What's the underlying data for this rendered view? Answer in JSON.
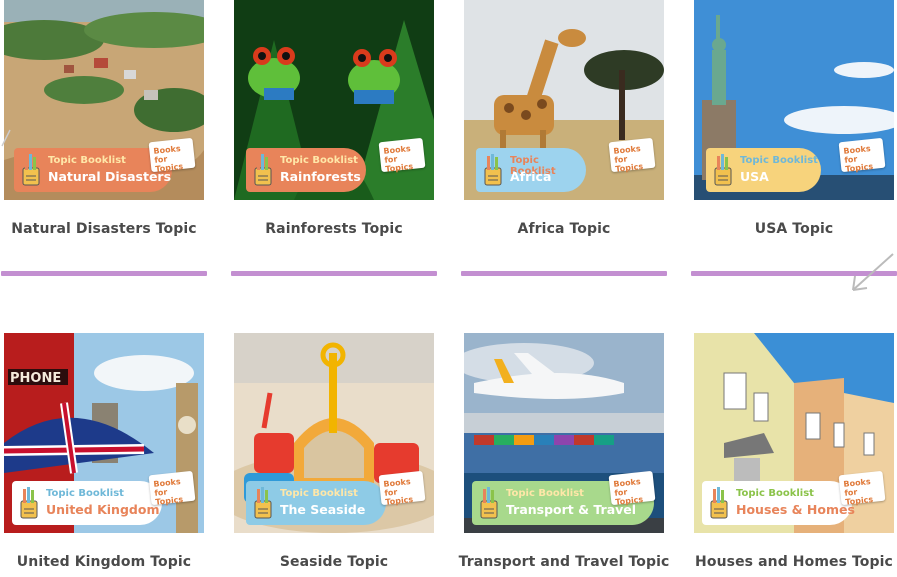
{
  "topics": [
    {
      "title": "Natural Disasters Topic",
      "banner": {
        "kicker": "Topic Booklist",
        "name": "Natural Disasters"
      },
      "logo": "Books for Topics",
      "colors": {
        "banner": "#e8845a",
        "kicker": "#ffe7a8",
        "name": "#ffffff"
      }
    },
    {
      "title": "Rainforests Topic",
      "banner": {
        "kicker": "Topic Booklist",
        "name": "Rainforests"
      },
      "logo": "Books for Topics",
      "colors": {
        "banner": "#e8845a",
        "kicker": "#ffe7a8",
        "name": "#ffffff"
      }
    },
    {
      "title": "Africa Topic",
      "banner": {
        "kicker": "Topic Booklist",
        "name": "Africa"
      },
      "logo": "Books for Topics",
      "colors": {
        "banner": "#9dd3ee",
        "kicker": "#e8845a",
        "name": "#ffffff"
      }
    },
    {
      "title": "USA Topic",
      "banner": {
        "kicker": "Topic Booklist",
        "name": "USA"
      },
      "logo": "Books for Topics",
      "colors": {
        "banner": "#f7d37c",
        "kicker": "#6fb8d8",
        "name": "#ffffff"
      }
    },
    {
      "title": "United Kingdom Topic",
      "banner": {
        "kicker": "Topic Booklist",
        "name": "United Kingdom"
      },
      "logo": "Books for Topics",
      "colors": {
        "banner": "#ffffff",
        "kicker": "#6fb8d8",
        "name": "#e8845a"
      }
    },
    {
      "title": "Seaside Topic",
      "banner": {
        "kicker": "Topic Booklist",
        "name": "The Seaside"
      },
      "logo": "Books for Topics",
      "colors": {
        "banner": "#8ecbe6",
        "kicker": "#ffe7a8",
        "name": "#ffffff"
      }
    },
    {
      "title": "Transport and Travel Topic",
      "banner": {
        "kicker": "Topic Booklist",
        "name": "Transport & Travel"
      },
      "logo": "Books for Topics",
      "colors": {
        "banner": "#a8d98c",
        "kicker": "#ffe7a8",
        "name": "#ffffff"
      }
    },
    {
      "title": "Houses and Homes Topic",
      "banner": {
        "kicker": "Topic Booklist",
        "name": "Houses & Homes"
      },
      "logo": "Books for Topics",
      "colors": {
        "banner": "#ffffff",
        "kicker": "#8bc34a",
        "name": "#e8845a"
      }
    }
  ],
  "accent_color": "#c38fd1",
  "icons": [
    "pencil-pot-icon",
    "books-for-topics-logo",
    "arrow-icon"
  ]
}
